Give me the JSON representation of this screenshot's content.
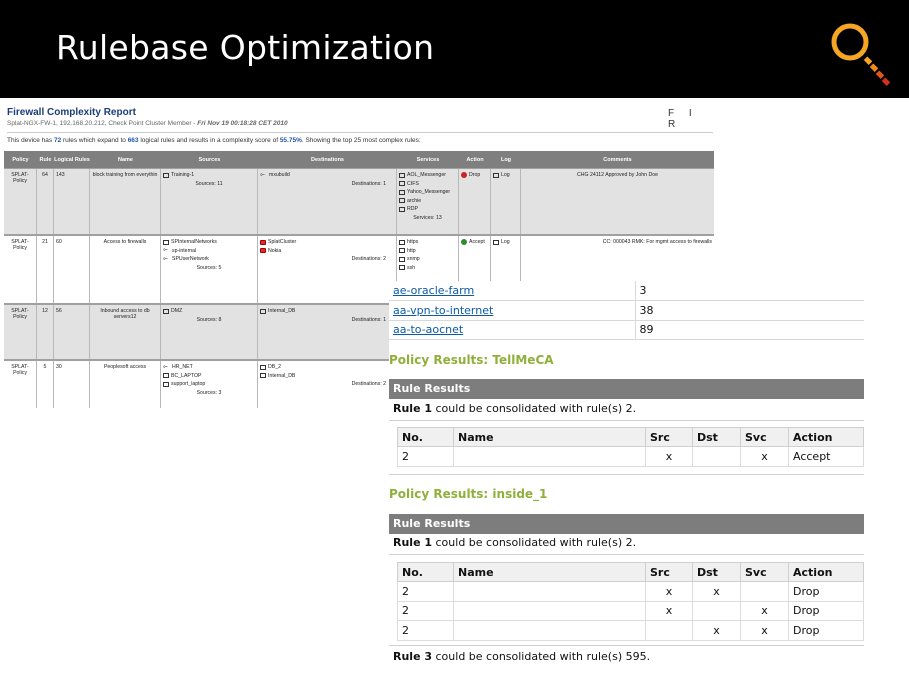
{
  "slide": {
    "title": "Rulebase Optimization"
  },
  "colors": {
    "banner": "#000000",
    "magnifier_ring": "#f5a623",
    "magnifier_handle": "#d0311b",
    "header_bar": "#7f7f7f",
    "policy_heading": "#8fb03a",
    "link": "#0b5aa8"
  },
  "report": {
    "title": "Firewall Complexity Report",
    "subtitle_prefix": "Splat-NGX-FW-1, 192.168.20.212, Check Point Cluster Member - ",
    "subtitle_date": "Fri Nov 19 00:18:28 CET 2010",
    "fir": "F I R",
    "summary_a": "This device has ",
    "summary_rules": "72",
    "summary_b": " rules which expand to ",
    "summary_logical": "663",
    "summary_c": " logical rules and results in a complexity score of ",
    "summary_score": "55.75%",
    "summary_d": ". Showing the top 25 most complex rules:",
    "columns": {
      "policy": "Policy",
      "rule": "Rule",
      "logical": "Logical Rules",
      "name": "Name",
      "sources": "Sources",
      "destinations": "Destinations",
      "services": "Services",
      "action": "Action",
      "log": "Log",
      "comments": "Comments"
    },
    "rows": [
      {
        "policy": "SPLAT-Policy",
        "rule": "64",
        "logical": "143",
        "name": "block training from everythin",
        "sources": [
          "Training-1"
        ],
        "sources_count": "Sources: 11",
        "destinations": [
          "mxubuild"
        ],
        "dest_count": "Destinations: 1",
        "services": [
          "AOL_Messenger",
          "CIFS",
          "Yahoo_Messenger",
          "archie",
          "RDP"
        ],
        "services_count": "Services: 13",
        "action": "Drop",
        "log": "Log",
        "comment": "CHG 24112 Approved by John Doe"
      },
      {
        "policy": "SPLAT-Policy",
        "rule": "21",
        "logical": "60",
        "name": "Access to firewalls",
        "sources": [
          "SPInternalNetworks",
          "sp-internal",
          "SPUserNetwork"
        ],
        "sources_count": "Sources: 5",
        "destinations": [
          "SplatCluster",
          "Nokia"
        ],
        "dest_count": "Destinations: 2",
        "services": [
          "https",
          "http",
          "snmp",
          "ssh"
        ],
        "services_count": "",
        "action": "Accept",
        "log": "Log",
        "comment": "CC: 000043 RMK: For mgmt access to firewalls"
      },
      {
        "policy": "SPLAT-Policy",
        "rule": "12",
        "logical": "56",
        "name": "Inbound access to db servers12",
        "sources": [
          "DMZ"
        ],
        "sources_count": "Sources: 8",
        "destinations": [
          "Internal_DB"
        ],
        "dest_count": "Destinations: 1",
        "services": [],
        "services_count": "",
        "action": "",
        "log": "",
        "comment": ""
      },
      {
        "policy": "SPLAT-Policy",
        "rule": "5",
        "logical": "30",
        "name": "Peoplesoft access",
        "sources": [
          "HR_NET",
          "BC_LAPTOP",
          "support_laptop"
        ],
        "sources_count": "Sources: 3",
        "destinations": [
          "DB_2",
          "Internal_DB"
        ],
        "dest_count": "Destinations: 2",
        "services": [],
        "services_count": "",
        "action": "",
        "log": "",
        "comment": ""
      }
    ]
  },
  "results": {
    "mini": [
      {
        "name": "ae-oracle-farm",
        "value": "3"
      },
      {
        "name": "aa-vpn-to-internet",
        "value": "38"
      },
      {
        "name": "aa-to-aocnet",
        "value": "89"
      }
    ],
    "policy1": {
      "heading": "Policy Results: TellMeCA",
      "bar": "Rule Results",
      "cons_rule": "Rule 1",
      "cons_text": " could be consolidated with rule(s) 2.",
      "headers": [
        "No.",
        "Name",
        "Src",
        "Dst",
        "Svc",
        "Action"
      ],
      "rows": [
        [
          "2",
          "",
          "x",
          "",
          "x",
          "Accept"
        ]
      ]
    },
    "policy2": {
      "heading": "Policy Results: inside_1",
      "bar": "Rule Results",
      "cons_rule": "Rule 1",
      "cons_text": " could be consolidated with rule(s) 2.",
      "headers": [
        "No.",
        "Name",
        "Src",
        "Dst",
        "Svc",
        "Action"
      ],
      "rows": [
        [
          "2",
          "",
          "x",
          "x",
          "",
          "Drop"
        ],
        [
          "2",
          "",
          "x",
          "",
          "x",
          "Drop"
        ],
        [
          "2",
          "",
          "",
          "x",
          "x",
          "Drop"
        ]
      ],
      "cons2_rule": "Rule 3",
      "cons2_text": " could be consolidated with rule(s) 595."
    }
  }
}
